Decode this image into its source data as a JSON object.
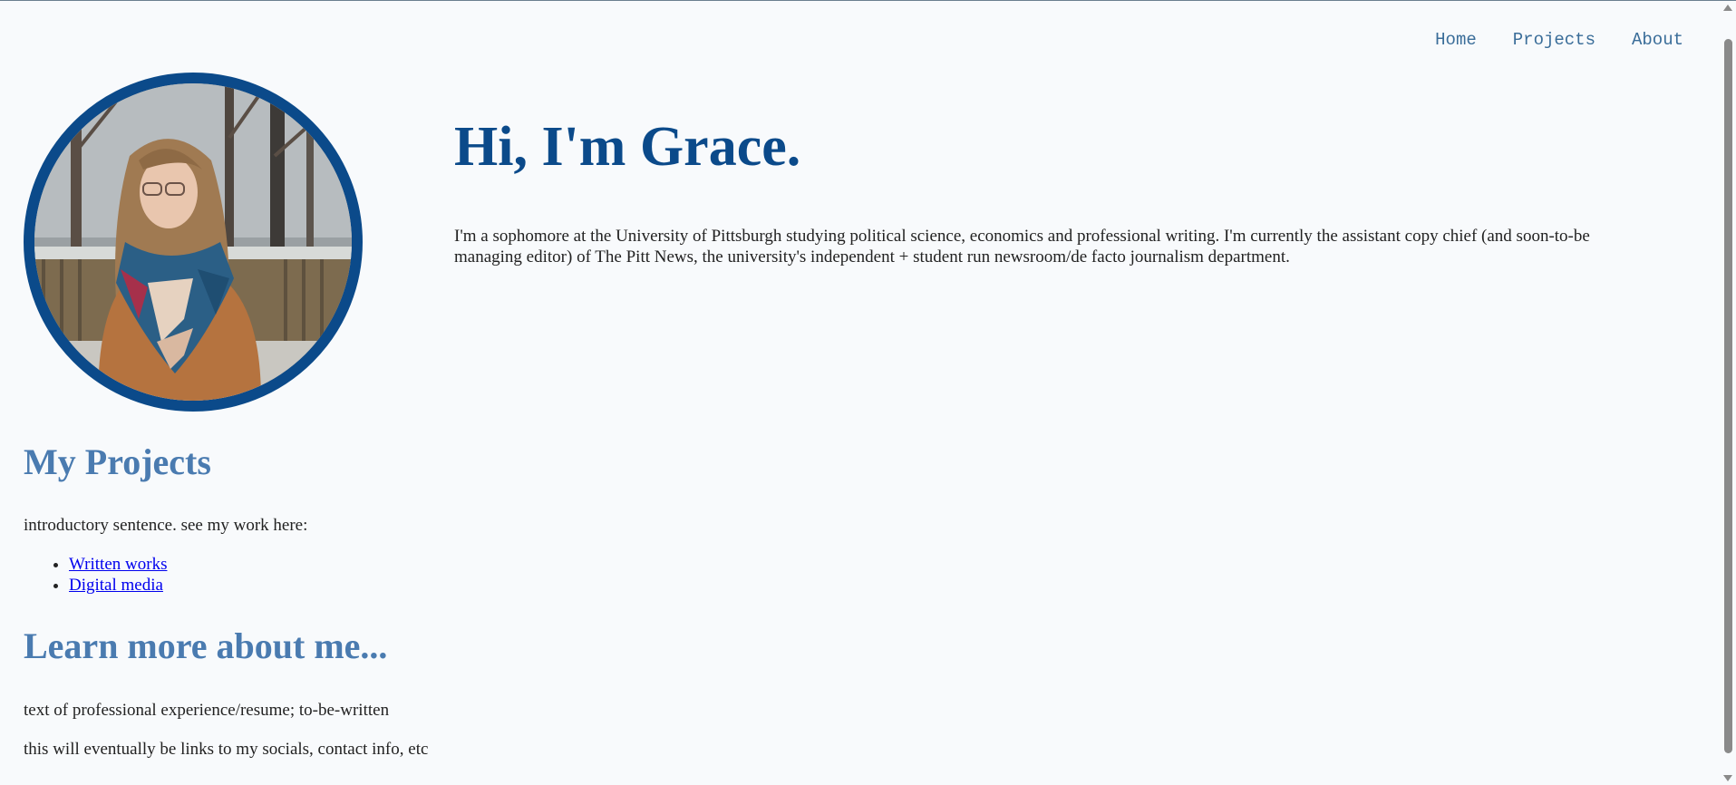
{
  "nav": {
    "items": [
      {
        "label": "Home"
      },
      {
        "label": "Projects"
      },
      {
        "label": "About"
      }
    ]
  },
  "hero": {
    "title": "Hi, I'm Grace.",
    "text": "I'm a sophomore at the University of Pittsburgh studying political science, economics and professional writing. I'm currently the assistant copy chief (and soon-to-be managing editor) of The Pitt News, the university's independent + student run newsroom/de facto journalism department."
  },
  "projects": {
    "title": "My Projects",
    "intro": "introductory sentence. see my work here:",
    "links": [
      {
        "label": "Written works"
      },
      {
        "label": "Digital media"
      }
    ]
  },
  "about": {
    "title": "Learn more about me...",
    "paragraphs": [
      "text of professional experience/resume; to-be-written",
      "this will eventually be links to my socials, contact info, etc"
    ]
  },
  "colors": {
    "accent": "#0b4a8a",
    "section_heading": "#4a7bb0",
    "nav_link": "#3a6d99",
    "background": "#f8fafc"
  }
}
